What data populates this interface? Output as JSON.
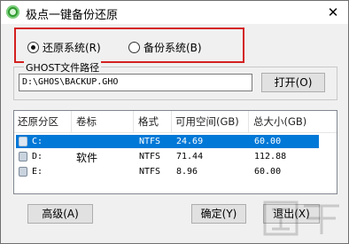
{
  "window": {
    "title": "极点一键备份还原",
    "close_glyph": "✕"
  },
  "mode": {
    "restore_label": "还原系统(R)",
    "backup_label": "备份系统(B)",
    "selected": "restore"
  },
  "ghost_path": {
    "group_label": "GHOST文件路径",
    "value": "D:\\GHOS\\BACKUP.GHO",
    "open_button": "打开(O)"
  },
  "partitions": {
    "columns": [
      "还原分区",
      "卷标",
      "格式",
      "可用空间(GB)",
      "总大小(GB)"
    ],
    "rows": [
      {
        "drive": "C:",
        "label": "",
        "format": "NTFS",
        "free": "24.69",
        "total": "60.00",
        "selected": true
      },
      {
        "drive": "D:",
        "label": "软件",
        "format": "NTFS",
        "free": "71.44",
        "total": "112.88",
        "selected": false
      },
      {
        "drive": "E:",
        "label": "",
        "format": "NTFS",
        "free": "8.96",
        "total": "60.00",
        "selected": false
      }
    ]
  },
  "buttons": {
    "advanced": "高级(A)",
    "ok": "确定(Y)",
    "exit": "退出(X)"
  },
  "colors": {
    "highlight": "#0078d7",
    "annotation_border": "#d42020"
  },
  "icons": {
    "app": "app-icon",
    "close": "close-icon",
    "drive": "disk-icon"
  }
}
